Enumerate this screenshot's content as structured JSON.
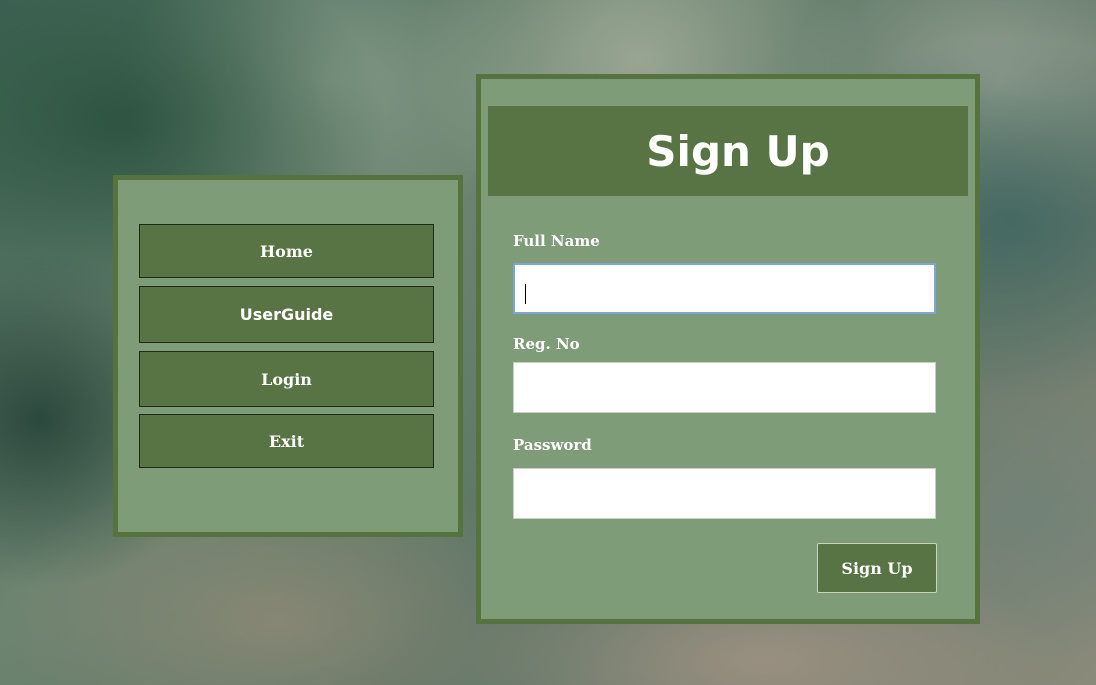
{
  "nav": {
    "items": [
      {
        "label": "Home"
      },
      {
        "label": "UserGuide"
      },
      {
        "label": "Login"
      },
      {
        "label": "Exit"
      }
    ]
  },
  "signup": {
    "title": "Sign Up",
    "fields": {
      "full_name": {
        "label": "Full Name",
        "value": ""
      },
      "reg_no": {
        "label": "Reg. No",
        "value": ""
      },
      "password": {
        "label": "Password",
        "value": ""
      }
    },
    "submit_label": "Sign Up"
  },
  "colors": {
    "panel_bg": "#7f9c79",
    "panel_border": "#55723f",
    "button_bg": "#587444",
    "text": "#ffffff",
    "focus_border": "#7aa5d6"
  }
}
